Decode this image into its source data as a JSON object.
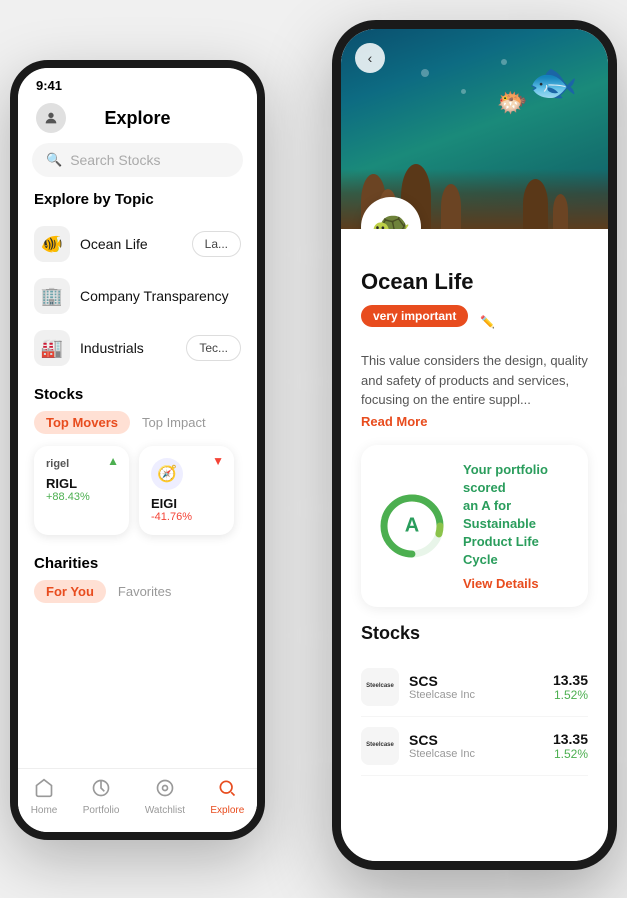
{
  "app": {
    "left_phone": {
      "status_time": "9:41",
      "header_title": "Explore",
      "search_placeholder": "Search Stocks",
      "explore_section_title": "Explore by Topic",
      "topics": [
        {
          "id": "ocean-life",
          "label": "Ocean Life",
          "icon": "🐠",
          "tag": "La..."
        },
        {
          "id": "company-transparency",
          "label": "Company Transparency",
          "icon": "🏢"
        },
        {
          "id": "industrials",
          "label": "Industrials",
          "icon": "🏭",
          "tag": "Tec..."
        }
      ],
      "stocks_section_title": "Stocks",
      "stocks_tabs": [
        {
          "label": "Top Movers",
          "active": true
        },
        {
          "label": "Top Impact",
          "active": false
        }
      ],
      "stocks": [
        {
          "ticker": "RIGL",
          "logo": "rigel",
          "change": "+88.43%",
          "up": true
        },
        {
          "ticker": "EIGI",
          "logo": "🧭",
          "change": "-41.76%",
          "up": false
        }
      ],
      "charities_title": "Charities",
      "charities_tabs": [
        {
          "label": "For You",
          "active": true
        },
        {
          "label": "Favorites",
          "active": false
        }
      ],
      "nav_items": [
        {
          "label": "Home",
          "icon": "△",
          "active": false
        },
        {
          "label": "Portfolio",
          "icon": "◎",
          "active": false
        },
        {
          "label": "Watchlist",
          "icon": "👁",
          "active": false
        },
        {
          "label": "Explore",
          "icon": "🔍",
          "active": true
        }
      ]
    },
    "right_phone": {
      "topic_title": "Ocean Life",
      "importance_badge": "very important",
      "description": "This value considers the design, quality and safety of products and services, focusing on the entire suppl...",
      "read_more": "Read More",
      "score_card": {
        "grade": "A",
        "text_line1": "Your portfolio scored",
        "text_grade": "an A for Sustainable",
        "text_line2": "Product Life Cycle",
        "view_details": "View Details"
      },
      "stocks_title": "Stocks",
      "stock_rows": [
        {
          "logo_text": "Steelcase",
          "ticker": "SCS",
          "name": "Steelcase Inc",
          "price": "13.35",
          "change": "1.52%"
        },
        {
          "logo_text": "Steelcase",
          "ticker": "SCS",
          "name": "Steelcase Inc",
          "price": "13.35",
          "change": "1.52%"
        }
      ]
    }
  }
}
